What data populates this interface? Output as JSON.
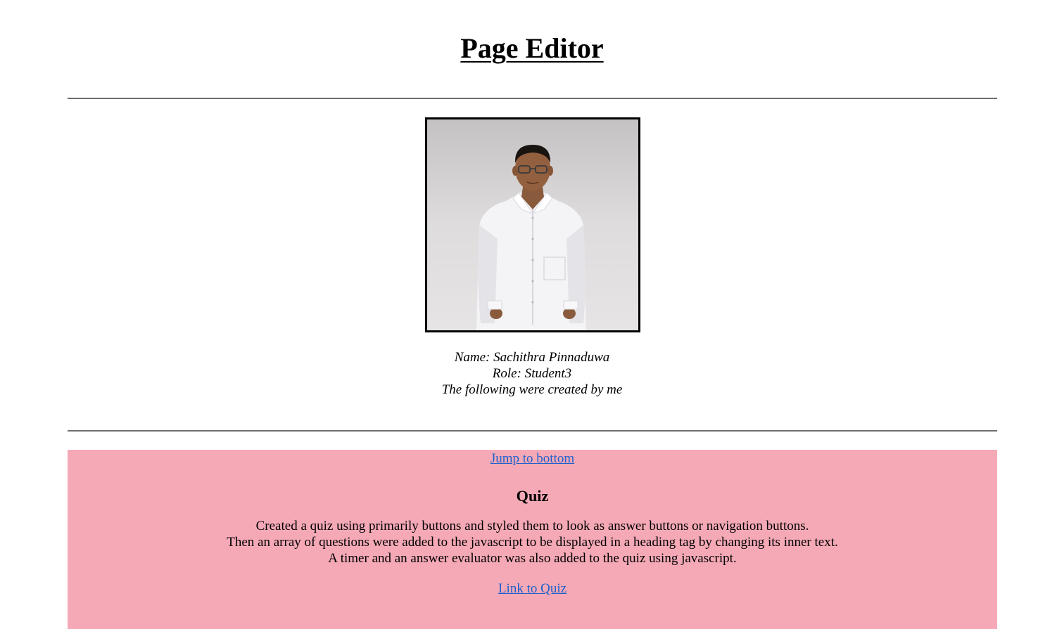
{
  "page": {
    "title": "Page Editor"
  },
  "profile": {
    "photo_alt": "Photo of Sachithra Pinnaduwa",
    "name_line": "Name: Sachithra Pinnaduwa",
    "role_line": "Role: Student3",
    "intro_line": "The following were created by me"
  },
  "project": {
    "jump_link": "Jump to bottom",
    "title": "Quiz",
    "description": [
      "Created a quiz using primarily buttons and styled them to look as answer buttons or navigation buttons.",
      "Then an array of questions were added to the javascript to be displayed in a heading tag by changing its inner text.",
      "A timer and an answer evaluator was also added to the quiz using javascript."
    ],
    "link": "Link to Quiz"
  },
  "colors": {
    "project_background": "#f5a9b6",
    "link": "#2060cc",
    "rule": "#6e6e6e"
  }
}
